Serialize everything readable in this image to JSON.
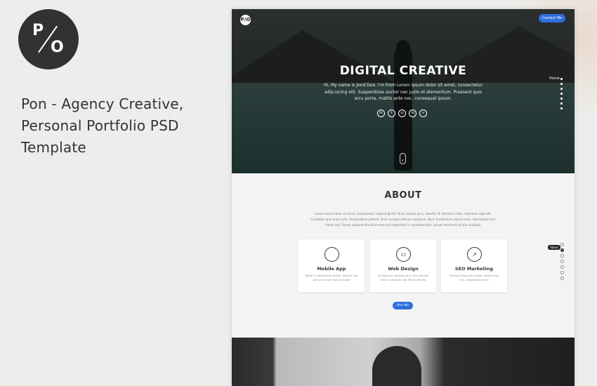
{
  "promo": {
    "logo_letter_1": "P",
    "logo_letter_2": "O",
    "title_line_1": "Pon - Agency Creative,",
    "title_line_2": "Personal Portfolio PSD",
    "title_line_3": "Template"
  },
  "mockup": {
    "mini_logo": "P/O",
    "contact_button": "Contact Me",
    "hero": {
      "title": "DIGITAL CREATIVE",
      "intro": "Hi, My name is Jond Doe. I'm from Lorem ipsum dolor sit amet, consectetur adip-iscing elit. Suspendisse auctor nec justo et elementum. Praesent quis arcu porta, mattis ante nec, consequat ipsum.",
      "nav_label": "Home",
      "socials": [
        "mail-icon",
        "twitter-icon",
        "dribbble-icon",
        "linkedin-icon",
        "vimeo-icon"
      ]
    },
    "about": {
      "title": "ABOUT",
      "text": "Lorem ipsum dolor sit amet, consectetur adipiscing elit. Nunc mauris arcu, lobortis id interdum vitae, interdum eget elit. Curabitur quis urna nulla. Suspendisse potenti. Duis suscipit ultrices maximus. Nunc fermentum mauris eros, sed tempor orci mollis sed. Donec placerat tincidunt eros vel imperdiet. In condimentum, ipsum hendrerit lacinia volutpat.",
      "badge": "About",
      "services": [
        {
          "icon": "apple-icon",
          "title": "Mobile App",
          "desc": "Nulla in malesuada dictum. Nullam nec varius mi quis nulla suscipit"
        },
        {
          "icon": "monitor-icon",
          "title": "Web Design",
          "desc": "Quisque ex vehicula orci, nec suscipit odio. In gravida nec leo id ultrices"
        },
        {
          "icon": "chart-icon",
          "title": "SEO Marketing",
          "desc": "Praesent quis arcu porta, mattis ante nec, consequat ipsum"
        }
      ],
      "hire_button": "Hire Me"
    },
    "accent_color": "#2f6fdc"
  }
}
